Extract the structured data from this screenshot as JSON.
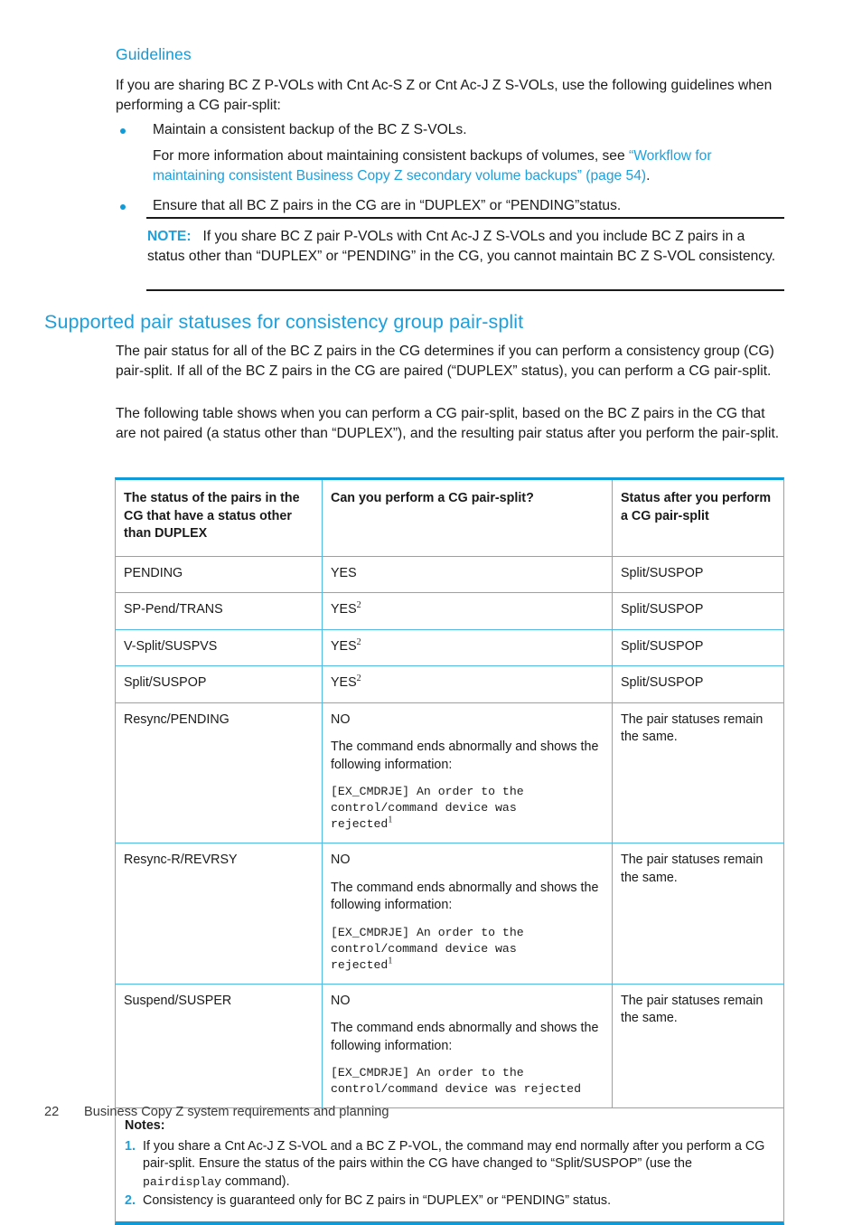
{
  "guidelines": {
    "heading": "Guidelines",
    "intro": "If you are sharing BC Z P-VOLs with Cnt Ac-S Z or Cnt Ac-J Z S-VOLs, use the following guidelines when performing a CG pair-split:",
    "bullet_1": "Maintain a consistent backup of the BC Z S-VOLs.",
    "bullet_1_sub_prefix": "For more information about maintaining consistent backups of volumes, see ",
    "bullet_1_sub_link": "“Workflow for maintaining consistent Business Copy Z secondary volume backups” (page 54)",
    "bullet_1_sub_suffix": ".",
    "bullet_2": "Ensure that all BC Z pairs in the CG are in “DUPLEX” or “PENDING”status.",
    "note_label": "NOTE:",
    "note_text": "If you share BC Z pair P-VOLs with Cnt Ac-J Z S-VOLs and you include BC Z pairs in a status other than “DUPLEX” or “PENDING” in the CG, you cannot maintain BC Z S-VOL consistency."
  },
  "section": {
    "heading": "Supported pair statuses for consistency group pair-split",
    "para_1": "The pair status for all of the BC Z pairs in the CG determines if you can perform a consistency group (CG) pair-split. If all of the BC Z pairs in the CG are paired (“DUPLEX” status), you can perform a CG pair-split.",
    "para_2": "The following table shows when you can perform a CG pair-split, based on the BC Z pairs in the CG that are not paired (a status other than “DUPLEX”), and the resulting pair status after you perform the pair-split."
  },
  "table": {
    "headers": [
      "The status of the pairs in the CG that have a status other than DUPLEX",
      "Can you perform a CG pair-split?",
      "Status after you perform a CG pair-split"
    ],
    "rows": [
      {
        "status": "PENDING",
        "answer": "YES",
        "answer_footnote": "",
        "detail": "",
        "code": "",
        "code_footnote": "",
        "result": "Split/SUSPOP"
      },
      {
        "status": "SP-Pend/TRANS",
        "answer": "YES",
        "answer_footnote": "2",
        "detail": "",
        "code": "",
        "code_footnote": "",
        "result": "Split/SUSPOP"
      },
      {
        "status": "V-Split/SUSPVS",
        "answer": "YES",
        "answer_footnote": "2",
        "detail": "",
        "code": "",
        "code_footnote": "",
        "result": "Split/SUSPOP"
      },
      {
        "status": "Split/SUSPOP",
        "answer": "YES",
        "answer_footnote": "2",
        "detail": "",
        "code": "",
        "code_footnote": "",
        "result": "Split/SUSPOP"
      },
      {
        "status": "Resync/PENDING",
        "answer": "NO",
        "answer_footnote": "",
        "detail": "The command ends abnormally and shows the following information:",
        "code": "[EX_CMDRJE] An order to the\ncontrol/command device was\nrejected",
        "code_footnote": "1",
        "result": "The pair statuses remain the same."
      },
      {
        "status": "Resync-R/REVRSY",
        "answer": "NO",
        "answer_footnote": "",
        "detail": "The command ends abnormally and shows the following information:",
        "code": "[EX_CMDRJE] An order to the\ncontrol/command device was\nrejected",
        "code_footnote": "1",
        "result": "The pair statuses remain the same."
      },
      {
        "status": "Suspend/SUSPER",
        "answer": "NO",
        "answer_footnote": "",
        "detail": "The command ends abnormally and shows the following information:",
        "code": "[EX_CMDRJE] An order to the\ncontrol/command device was rejected",
        "code_footnote": "",
        "result": "The pair statuses remain the same."
      }
    ],
    "notes_title": "Notes:",
    "notes": [
      {
        "num": "1.",
        "part_a": "If you share a Cnt Ac-J Z S-VOL and a BC Z P-VOL, the command may end normally after you perform a CG pair-split. Ensure the status of the pairs within the CG have changed to “Split/SUSPOP” (use the ",
        "mono": "pairdisplay",
        "part_b": " command)."
      },
      {
        "num": "2.",
        "part_a": "Consistency is guaranteed only for BC Z pairs in “DUPLEX” or “PENDING” status.",
        "mono": "",
        "part_b": ""
      }
    ]
  },
  "footer": {
    "page_number": "22",
    "chapter_title": "Business Copy Z system requirements and planning"
  },
  "colors": {
    "accent_blue": "#1da0dc",
    "heading_blue": "#0f9bd7",
    "rule_blue": "#4fbbe4",
    "text": "#1a1a1a"
  }
}
